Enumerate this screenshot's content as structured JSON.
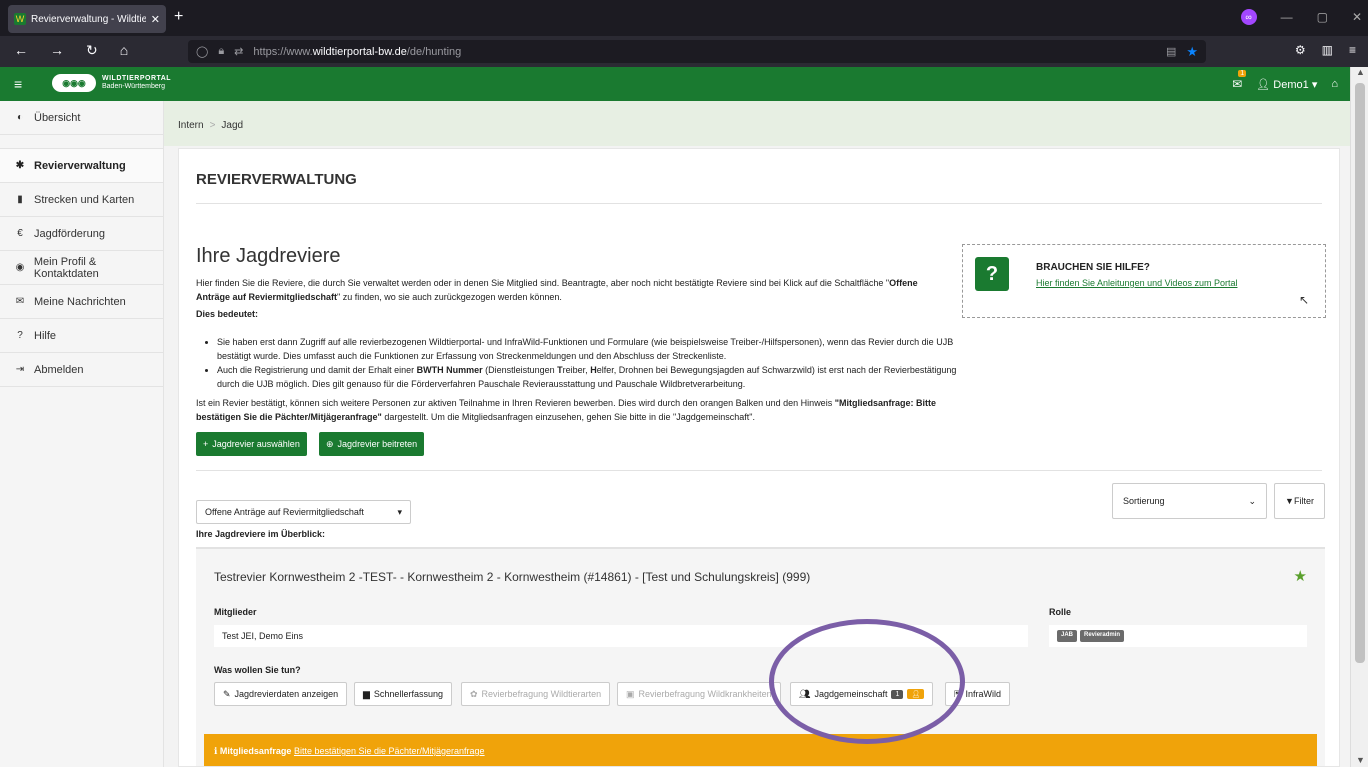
{
  "browser": {
    "tab_title": "Revierverwaltung - Wildtierport",
    "new_tab": "+",
    "url_prefix": "https://www.",
    "url_domain": "wildtierportal-bw.de",
    "url_path": "/de/hunting"
  },
  "app": {
    "logo_title": "WILDTIERPORTAL",
    "logo_subtitle": "Baden-Württemberg",
    "mail_badge": "1",
    "user_menu": "Demo1"
  },
  "sidebar": {
    "items": [
      {
        "label": "Übersicht",
        "icon": "dashboard-icon"
      },
      {
        "label": "Revierverwaltung",
        "icon": "gear-icon"
      },
      {
        "label": "Strecken und Karten",
        "icon": "map-icon"
      },
      {
        "label": "Jagdförderung",
        "icon": "euro-icon"
      },
      {
        "label": "Mein Profil & Kontaktdaten",
        "icon": "user-icon"
      },
      {
        "label": "Meine Nachrichten",
        "icon": "mail-icon"
      },
      {
        "label": "Hilfe",
        "icon": "help-icon"
      },
      {
        "label": "Abmelden",
        "icon": "logout-icon"
      }
    ]
  },
  "breadcrumb": {
    "items": [
      "Intern",
      "Jagd"
    ],
    "sep": ">"
  },
  "page": {
    "title": "REVIERVERWALTUNG",
    "heading": "Ihre Jagdreviere",
    "intro_1": "Hier finden Sie die Reviere, die durch Sie verwaltet werden oder in denen Sie Mitglied sind. Beantragte, aber noch nicht bestätigte Reviere sind bei Klick auf die Schaltfläche \"",
    "intro_bold": "Offene Anträge auf Reviermitgliedschaft",
    "intro_2": "\" zu finden, wo sie auch zurückgezogen werden können.",
    "meaning": "Dies bedeutet:",
    "bullet_1": "Sie haben erst dann Zugriff auf alle revierbezogenen Wildtierportal- und InfraWild-Funktionen und Formulare (wie beispielsweise Treiber-/Hilfspersonen), wenn das Revier durch die UJB bestätigt wurde. Dies umfasst auch die Funktionen zur Erfassung von Streckenmeldungen und den Abschluss der Streckenliste.",
    "bullet_2a": "Auch die Registrierung und damit der Erhalt einer ",
    "bullet_2b": "BWTH Nummer",
    "bullet_2c": " (Dienstleistungen ",
    "bullet_2d": "T",
    "bullet_2e": "reiber, ",
    "bullet_2f": "H",
    "bullet_2g": "elfer, Drohnen bei Bewegungsjagden auf Schwarzwild) ist erst nach der Revierbestätigung durch die UJB möglich. Dies gilt genauso für die Förderverfahren Pauschale Revierausstattung und Pauschale Wildbretverarbeitung.",
    "para2_a": "Ist ein Revier bestätigt, können sich weitere Personen zur aktiven Teilnahme in Ihren Revieren bewerben. Dies wird durch den orangen Balken und den Hinweis ",
    "para2_b": "\"Mitgliedsanfrage: Bitte bestätigen Sie die Pächter/Mitjägeranfrage\"",
    "para2_c": " dargestellt. Um die Mitgliedsanfragen einzusehen, gehen Sie bitte in die \"Jagdgemeinschaft\".",
    "btn_select": "Jagdrevier auswählen",
    "btn_join": "Jagdrevier beitreten",
    "help_title": "BRAUCHEN SIE HILFE?",
    "help_link": "Hier finden Sie Anleitungen und Videos zum Portal",
    "dropdown": "Offene Anträge auf Reviermitgliedschaft",
    "sort": "Sortierung",
    "filter": "Filter",
    "overview": "Ihre Jagdreviere im Überblick:"
  },
  "card": {
    "title": "Testrevier Kornwestheim 2 -TEST- - Kornwestheim 2 - Kornwestheim (#14861) - [Test und Schulungskreis] (999)",
    "members_label": "Mitglieder",
    "members_value": "Test JEI, Demo Eins",
    "role_label": "Rolle",
    "roles": [
      "JAB",
      "Revieradmin"
    ],
    "actions_label": "Was wollen Sie tun?",
    "actions": {
      "view": "Jagdrevierdaten anzeigen",
      "quick": "Schnellerfassung",
      "survey_species": "Revierbefragung Wildtierarten",
      "survey_disease": "Revierbefragung Wildkrankheiten",
      "community": "Jagdgemeinschaft",
      "community_count": "1",
      "infrawild": "InfraWild"
    },
    "alert_bold": "Mitgliedsanfrage",
    "alert_link": "Bitte bestätigen Sie die Pächter/Mitjägeranfrage"
  },
  "colors": {
    "brand_green": "#1a7a30",
    "accent_orange": "#f0a30a",
    "annotation_purple": "#7b5ea7"
  }
}
